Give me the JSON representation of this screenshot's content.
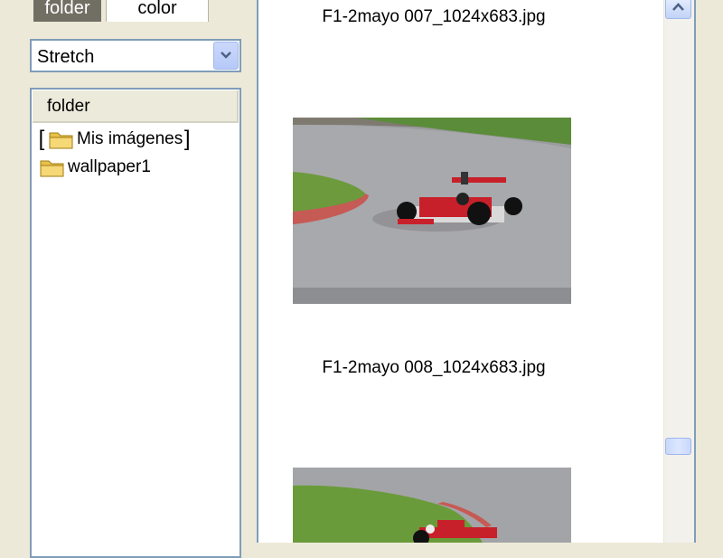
{
  "tabs": {
    "folder_label": "folder",
    "color_label": "color"
  },
  "view_mode": {
    "selected": "Stretch",
    "icon": "chevron-down-icon"
  },
  "tree": {
    "header": "folder",
    "items": [
      {
        "label": "Mis imágenes",
        "icon": "folder-icon",
        "selected": true
      },
      {
        "label": "wallpaper1",
        "icon": "folder-icon",
        "selected": false
      }
    ]
  },
  "gallery": {
    "items": [
      {
        "filename": "F1-2mayo 007_1024x683.jpg"
      },
      {
        "filename": "F1-2mayo 008_1024x683.jpg"
      }
    ]
  },
  "scrollbar": {
    "up_icon": "chevron-up-icon",
    "position": 0.82
  },
  "colors": {
    "border": "#7f9db9",
    "active_tab": "#716f64",
    "background": "#ece9d8"
  }
}
